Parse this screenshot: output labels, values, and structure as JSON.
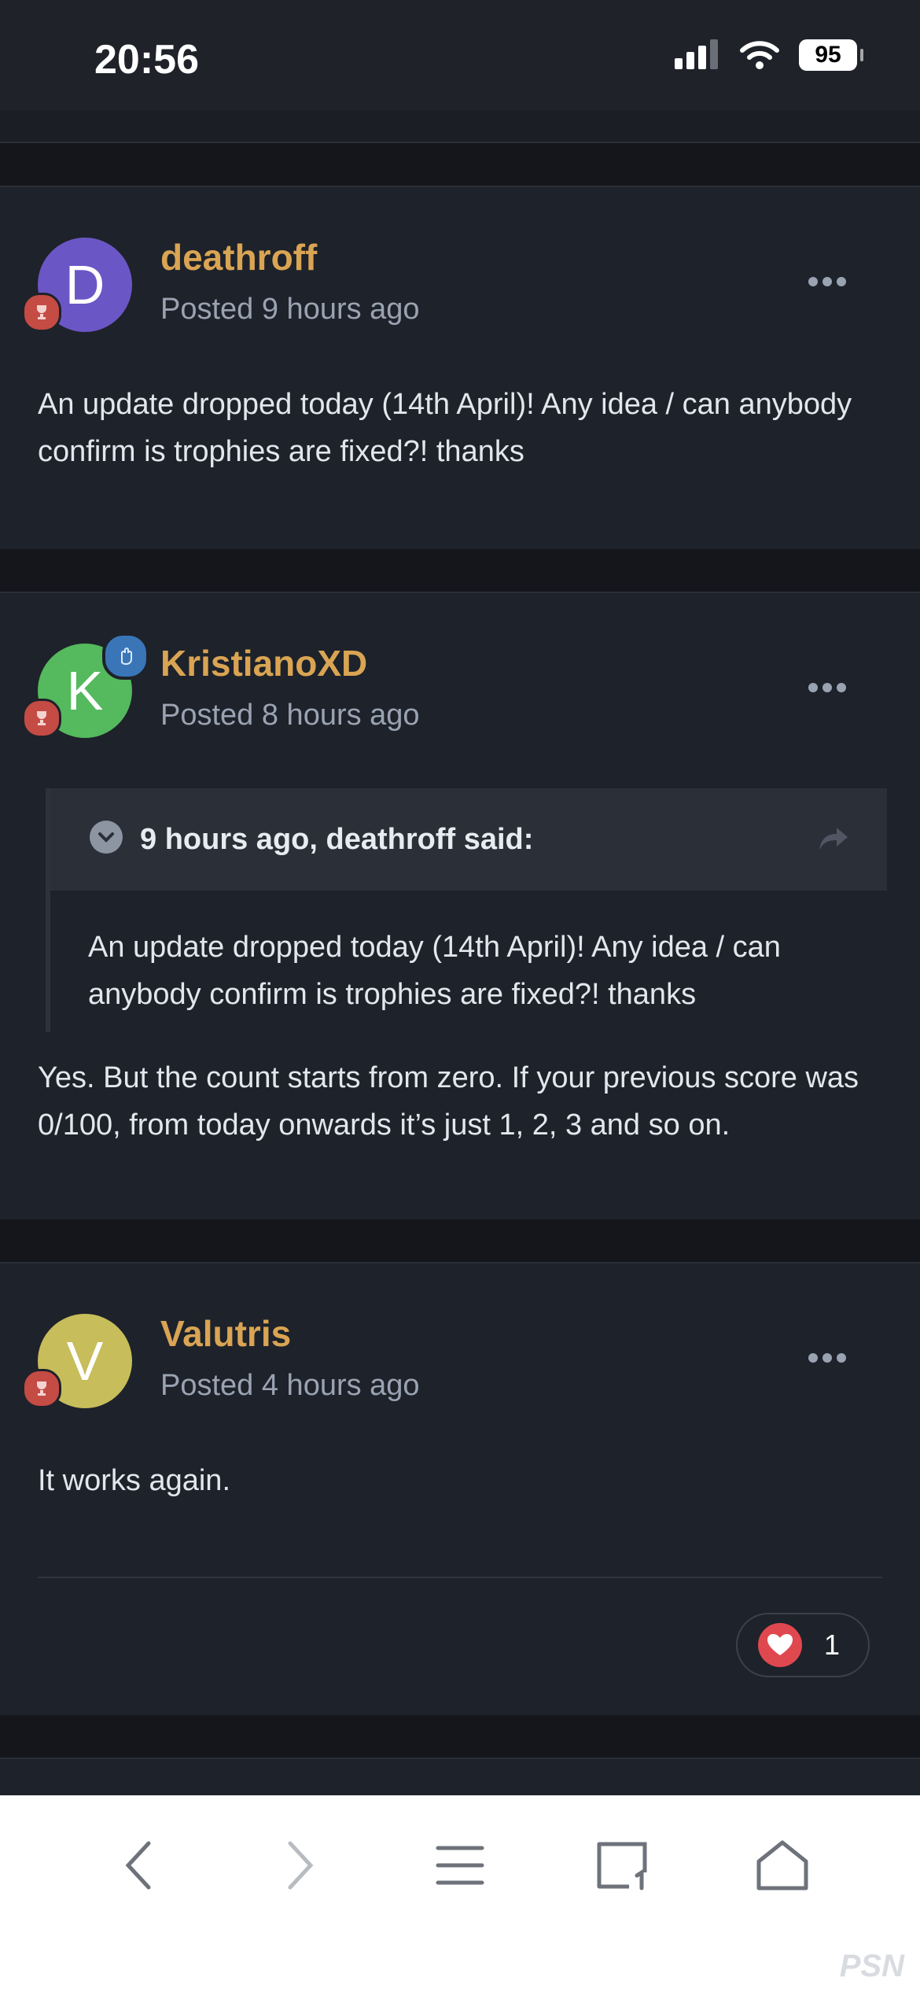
{
  "status_bar": {
    "time": "20:56",
    "battery": "95"
  },
  "posts": [
    {
      "author": "deathroff",
      "avatar_letter": "D",
      "avatar_color": "#6b56c6",
      "posted": "Posted 9 hours ago",
      "body": "An update dropped today (14th April)! Any idea / can anybody confirm is trophies are fixed?! thanks"
    },
    {
      "author": "KristianoXD",
      "avatar_letter": "K",
      "avatar_color": "#55b95d",
      "posted": "Posted 8 hours ago",
      "quote": {
        "header": "9 hours ago, deathroff said:",
        "body": "An update dropped today (14th April)! Any idea / can anybody confirm is trophies are fixed?! thanks"
      },
      "body": "Yes. But the count starts from zero. If your previous score was 0/100, from today onwards it’s just 1, 2, 3 and so on."
    },
    {
      "author": "Valutris",
      "avatar_letter": "V",
      "avatar_color": "#c7bd5a",
      "posted": "Posted 4 hours ago",
      "body": "It works again.",
      "reaction_count": "1"
    }
  ],
  "watermark": "PSN"
}
